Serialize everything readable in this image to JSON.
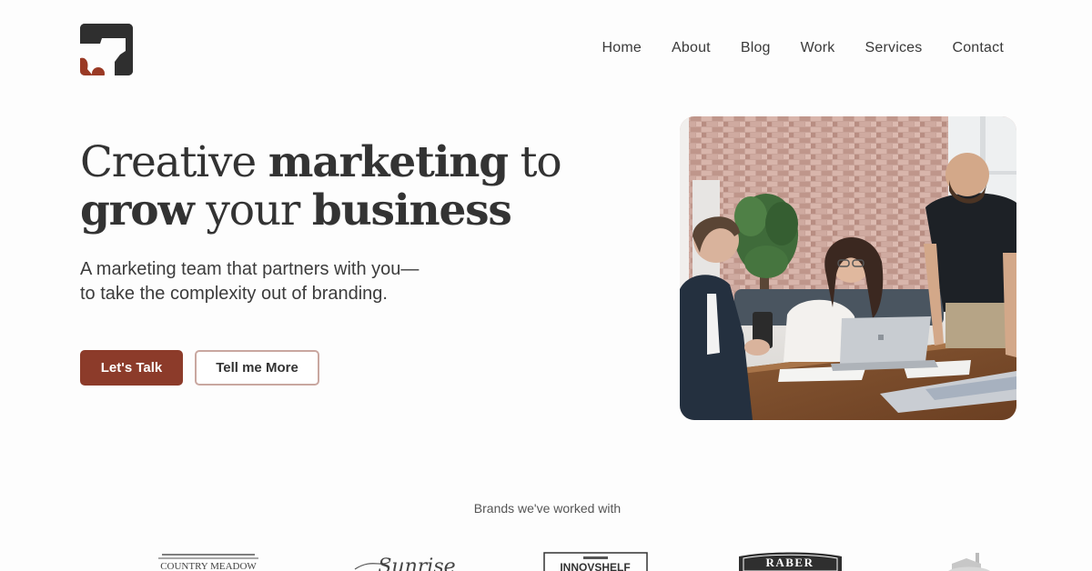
{
  "nav": {
    "items": [
      {
        "label": "Home"
      },
      {
        "label": "About"
      },
      {
        "label": "Blog"
      },
      {
        "label": "Work"
      },
      {
        "label": "Services"
      },
      {
        "label": "Contact"
      }
    ]
  },
  "hero": {
    "headline": {
      "line1": {
        "part1": "Creative ",
        "part2": "marketing",
        "part3": " to"
      },
      "line2": {
        "part1": "grow",
        "part2": " your ",
        "part3": "business"
      }
    },
    "subtitle_line1": "A marketing team that partners with you—",
    "subtitle_line2": "to take the complexity out of branding.",
    "primary_button": "Let's Talk",
    "secondary_button": "Tell me More"
  },
  "brands": {
    "title": "Brands we've worked with",
    "logos": [
      {
        "text": "COUNTRY MEADOW"
      },
      {
        "text": "Sunrise"
      },
      {
        "text": "INNOVSHELF"
      },
      {
        "text": "RABER"
      },
      {
        "icon": "farm-icon"
      }
    ]
  },
  "colors": {
    "accent": "#8c3b2a",
    "text": "#333333",
    "secondary_border": "#c9a7a0",
    "background": "#fdfdfd"
  }
}
